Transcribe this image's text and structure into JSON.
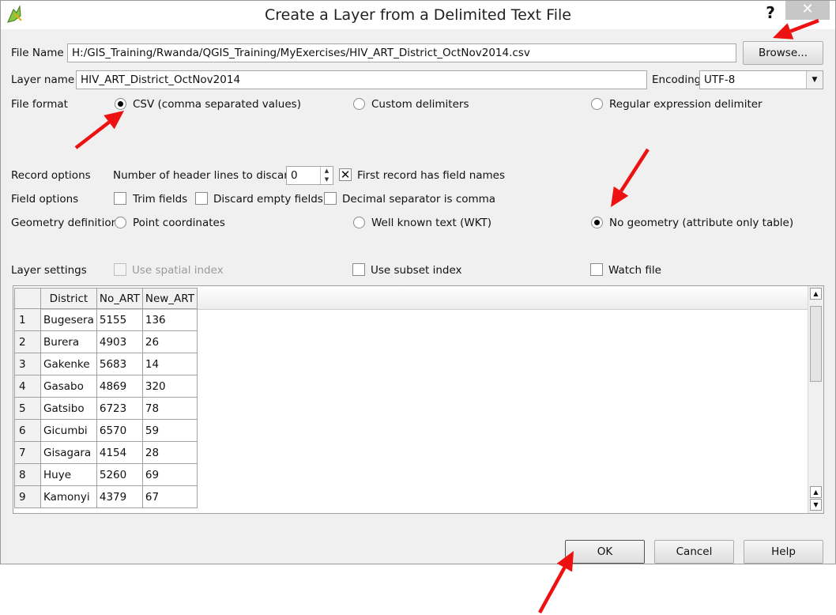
{
  "window": {
    "title": "Create a Layer from a Delimited Text File",
    "help": "?",
    "close": "✕"
  },
  "file": {
    "name_label": "File Name",
    "path": "H:/GIS_Training/Rwanda/QGIS_Training/MyExercises/HIV_ART_District_OctNov2014.csv",
    "browse": "Browse..."
  },
  "layer": {
    "name_label": "Layer name",
    "name": "HIV_ART_District_OctNov2014",
    "encoding_label": "Encoding",
    "encoding": "UTF-8"
  },
  "format": {
    "label": "File format",
    "csv": "CSV (comma separated values)",
    "custom": "Custom delimiters",
    "regex": "Regular expression delimiter",
    "selected": "csv"
  },
  "record": {
    "label": "Record options",
    "header_lines_label": "Number of header lines to discard",
    "header_lines": "0",
    "first_record": "First record has field names",
    "first_record_checked": true
  },
  "field": {
    "label": "Field options",
    "trim": "Trim fields",
    "discard_empty": "Discard empty fields",
    "decimal_comma": "Decimal separator is comma"
  },
  "geometry": {
    "label": "Geometry definition",
    "point": "Point coordinates",
    "wkt": "Well known text (WKT)",
    "none": "No geometry (attribute only table)",
    "selected": "none"
  },
  "settings": {
    "label": "Layer settings",
    "spatial_index": "Use spatial index",
    "subset_index": "Use subset index",
    "watch_file": "Watch file"
  },
  "table": {
    "columns": [
      "District",
      "No_ART",
      "New_ART"
    ],
    "rows": [
      [
        "1",
        "Bugesera",
        "5155",
        "136"
      ],
      [
        "2",
        "Burera",
        "4903",
        "26"
      ],
      [
        "3",
        "Gakenke",
        "5683",
        "14"
      ],
      [
        "4",
        "Gasabo",
        "4869",
        "320"
      ],
      [
        "5",
        "Gatsibo",
        "6723",
        "78"
      ],
      [
        "6",
        "Gicumbi",
        "6570",
        "59"
      ],
      [
        "7",
        "Gisagara",
        "4154",
        "28"
      ],
      [
        "8",
        "Huye",
        "5260",
        "69"
      ],
      [
        "9",
        "Kamonyi",
        "4379",
        "67"
      ]
    ]
  },
  "buttons": {
    "ok": "OK",
    "cancel": "Cancel",
    "help": "Help"
  },
  "colors": {
    "annotation_arrow": "#ee1111"
  }
}
